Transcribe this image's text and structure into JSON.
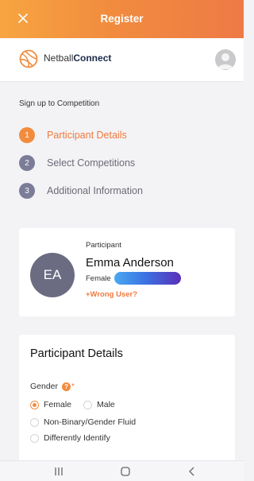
{
  "topbar": {
    "title": "Register",
    "close_icon": "close-icon"
  },
  "brand": {
    "name_part1": "Netball",
    "name_part2": "Connect",
    "logo_icon": "netball-logo-icon",
    "avatar_icon": "user-avatar-icon"
  },
  "signup": {
    "label": "Sign up to Competition",
    "steps": [
      {
        "number": "1",
        "label": "Participant Details",
        "state": "active"
      },
      {
        "number": "2",
        "label": "Select Competitions",
        "state": "inactive"
      },
      {
        "number": "3",
        "label": "Additional Information",
        "state": "inactive"
      }
    ]
  },
  "participant": {
    "label": "Participant",
    "initials": "EA",
    "name": "Emma Anderson",
    "gender": "Female",
    "wrong_user": "+Wrong User?"
  },
  "details": {
    "title": "Participant Details",
    "gender_label": "Gender",
    "required_mark": "*",
    "help_icon": "?",
    "options": [
      {
        "label": "Female",
        "checked": true
      },
      {
        "label": "Male",
        "checked": false
      },
      {
        "label": "Non-Binary/Gender Fluid",
        "checked": false
      },
      {
        "label": "Differently Identify",
        "checked": false
      }
    ]
  },
  "colors": {
    "accent": "#f18c3f",
    "step_inactive": "#7b7c98",
    "avatar_bg": "#6b6b82"
  },
  "navbar": {
    "icons": [
      "recent-apps-icon",
      "home-icon",
      "back-icon"
    ]
  }
}
